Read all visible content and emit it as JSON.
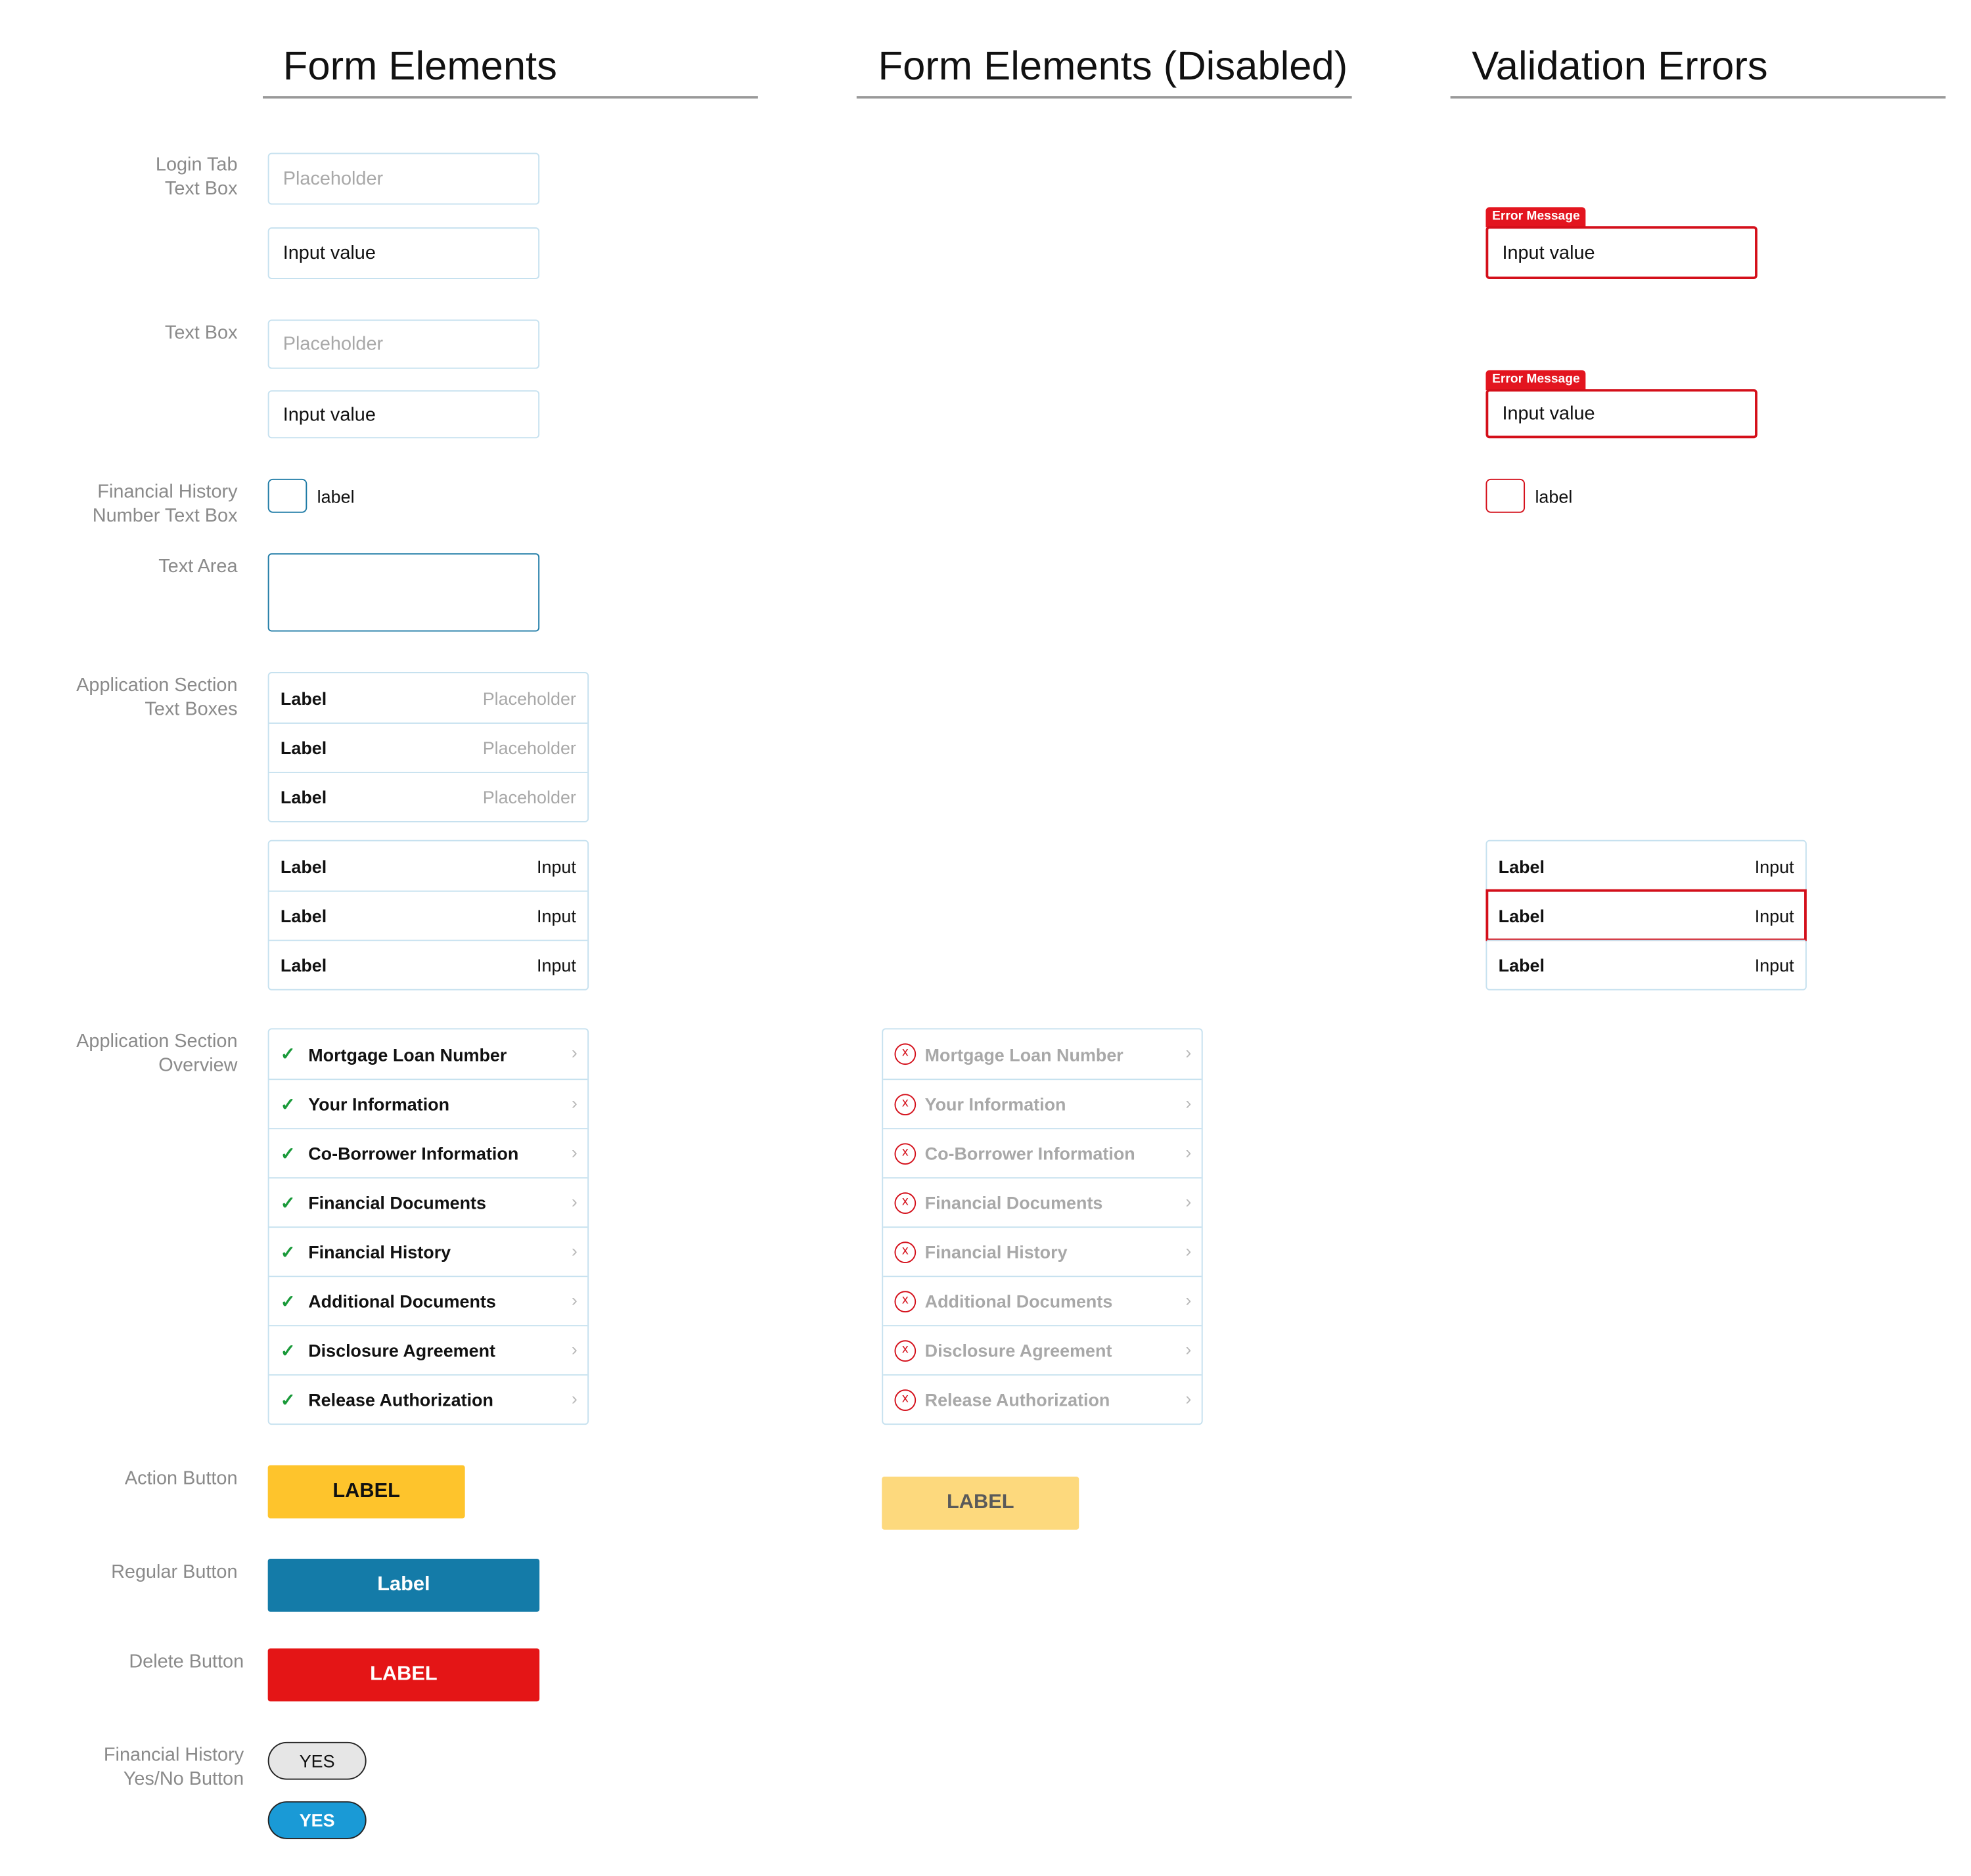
{
  "columns": {
    "form": "Form Elements",
    "disabled": "Form Elements (Disabled)",
    "validation": "Validation Errors"
  },
  "row_labels": {
    "login_line1": "Login Tab",
    "login_line2": "Text Box",
    "textbox": "Text Box",
    "fin_num_line1": "Financial History",
    "fin_num_line2": "Number Text Box",
    "textarea": "Text Area",
    "app_text_line1": "Application Section",
    "app_text_line2": "Text Boxes",
    "app_over_line1": "Application Section",
    "app_over_line2": "Overview",
    "action": "Action Button",
    "regular": "Regular Button",
    "delete": "Delete Button",
    "yesno_line1": "Financial History",
    "yesno_line2": "Yes/No Button"
  },
  "fields": {
    "placeholder": "Placeholder",
    "input_value": "Input value",
    "checkbox_label": "label",
    "error_message": "Error Message"
  },
  "app_text_rows": {
    "label": "Label",
    "placeholder": "Placeholder",
    "input": "Input"
  },
  "overview_items": [
    "Mortgage Loan Number",
    "Your Information",
    "Co-Borrower Information",
    "Financial Documents",
    "Financial History",
    "Additional Documents",
    "Disclosure Agreement",
    "Release Authorization"
  ],
  "icons": {
    "check": "check-icon",
    "chevron": "chevron-right-icon",
    "error": "x-circle-icon"
  },
  "glyphs": {
    "check": "✓",
    "chevron": "›",
    "x": "x"
  },
  "buttons": {
    "action": "LABEL",
    "action_disabled": "LABEL",
    "regular": "Label",
    "delete": "LABEL",
    "yes_off": "YES",
    "yes_on": "YES"
  },
  "colors": {
    "action": "#fec42c",
    "action_disabled": "#fdd97d",
    "regular": "#147ba8",
    "delete": "#e41516",
    "error": "#d40f1a",
    "yes_on": "#1a9ad6",
    "check": "#1a9a3a",
    "field_border": "#c6e1ef"
  }
}
